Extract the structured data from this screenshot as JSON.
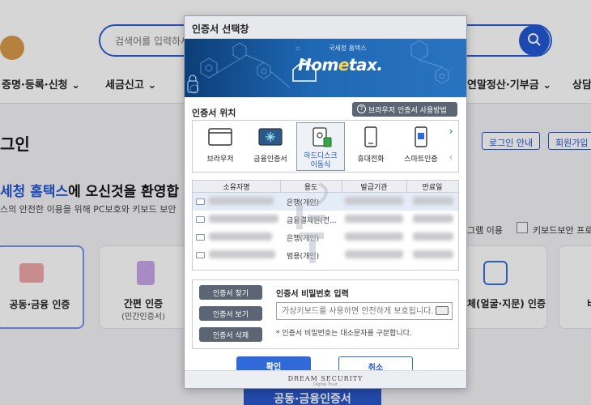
{
  "background": {
    "search_placeholder": "검색어를 입력하세",
    "nav": [
      "증명·등록·신청",
      "세금신고",
      "연말정산·기부금",
      "상담"
    ],
    "login_title": "그인",
    "login_guide": "로그인 안내",
    "signup": "회원가입",
    "welcome_highlight": "세청 홈택스",
    "welcome_rest": "에 오신것을 환영합",
    "welcome_sub": "스의 안전한 이용을 위해 PC보호와 키보드 보안",
    "option_program": "그램 이용",
    "option_keyboard": "키보드보안 프로",
    "cards": {
      "joint_cert": "공동·금융 인증",
      "simple_cert": "간편 인증",
      "simple_cert_sub": "(민간인증서)",
      "bio_cert": "체(얼굴·지문) 인증",
      "right_edge": "비"
    },
    "bottom_button": "공동·금융인증서"
  },
  "dialog": {
    "title": "인증서 선택창",
    "banner_sub": "국세청 홈택스",
    "banner_logo_pre": "Hom",
    "banner_logo_e": "e",
    "banner_logo_post": "tax.",
    "location_title": "인증서 위치",
    "browser_help": "브라우저 인증서 사용방법",
    "devices": [
      {
        "label": "브라우저"
      },
      {
        "label": "금융인증서"
      },
      {
        "label": "하드디스크\n이동식"
      },
      {
        "label": "휴대전화"
      },
      {
        "label": "스마트인증"
      }
    ],
    "table": {
      "headers": [
        "소유자명",
        "용도",
        "발급기관",
        "만료일"
      ],
      "rows": [
        {
          "usage": "은행(개인)"
        },
        {
          "usage": "금융결제원(전..."
        },
        {
          "usage": "은행(개인)"
        },
        {
          "usage": "범용(개인)"
        }
      ]
    },
    "side_buttons": [
      "인증서 찾기",
      "인증서 보기",
      "인증서 삭제"
    ],
    "password_title": "인증서 비밀번호 입력",
    "password_placeholder": "가상키보드를 사용하면 안전하게 보호됩니다.",
    "password_note": "* 인증서 비밀번호는 대소문자를 구분합니다.",
    "ok": "확인",
    "cancel": "취소",
    "footer_brand": "DREAM SECURITY",
    "footer_tag": "Digital Trust"
  },
  "colors": {
    "accent": "#2f6ad8",
    "banner_dark": "#0c3e77",
    "gray_button": "#5b6573"
  }
}
